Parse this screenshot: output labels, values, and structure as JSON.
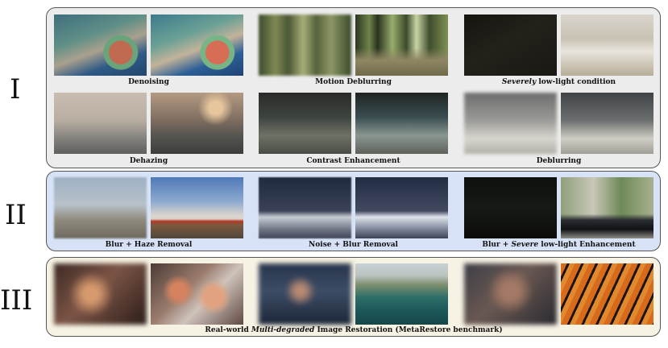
{
  "rows": {
    "i": "I",
    "ii": "II",
    "iii": "III"
  },
  "captions": {
    "denoising": "Denoising",
    "motion_deblurring": "Motion Deblurring",
    "severely_word": "Severely",
    "lowlight_rest": " low-light condition",
    "dehazing": "Dehazing",
    "contrast": "Contrast Enhancement",
    "deblurring": "Deblurring",
    "blur_haze": "Blur + Haze Removal",
    "noise_blur": "Noise + Blur Removal",
    "blur_severe_prefix": "Blur + ",
    "blur_severe_word": "Severe",
    "blur_severe_suffix": " low-light Enhancement",
    "realworld_prefix": "Real-world ",
    "realworld_word": "Multi-degraded",
    "realworld_suffix": " Image Restoration (MetaRestore benchmark)"
  },
  "images": {
    "row1": [
      "harbor-degraded",
      "harbor-restored",
      "forest-degraded",
      "forest-restored",
      "room-degraded",
      "room-restored"
    ],
    "row2": [
      "haze-degraded",
      "haze-restored",
      "lobby-degraded",
      "lobby-restored",
      "street-degraded",
      "street-restored"
    ],
    "row3": [
      "sky-degraded",
      "sky-restored",
      "snow-degraded",
      "snow-restored",
      "car-degraded",
      "car-restored"
    ],
    "row4": [
      "octopus-degraded",
      "octopus-restored",
      "cliff-degraded",
      "cliff-restored",
      "tiger-degraded",
      "tiger-restored"
    ]
  }
}
